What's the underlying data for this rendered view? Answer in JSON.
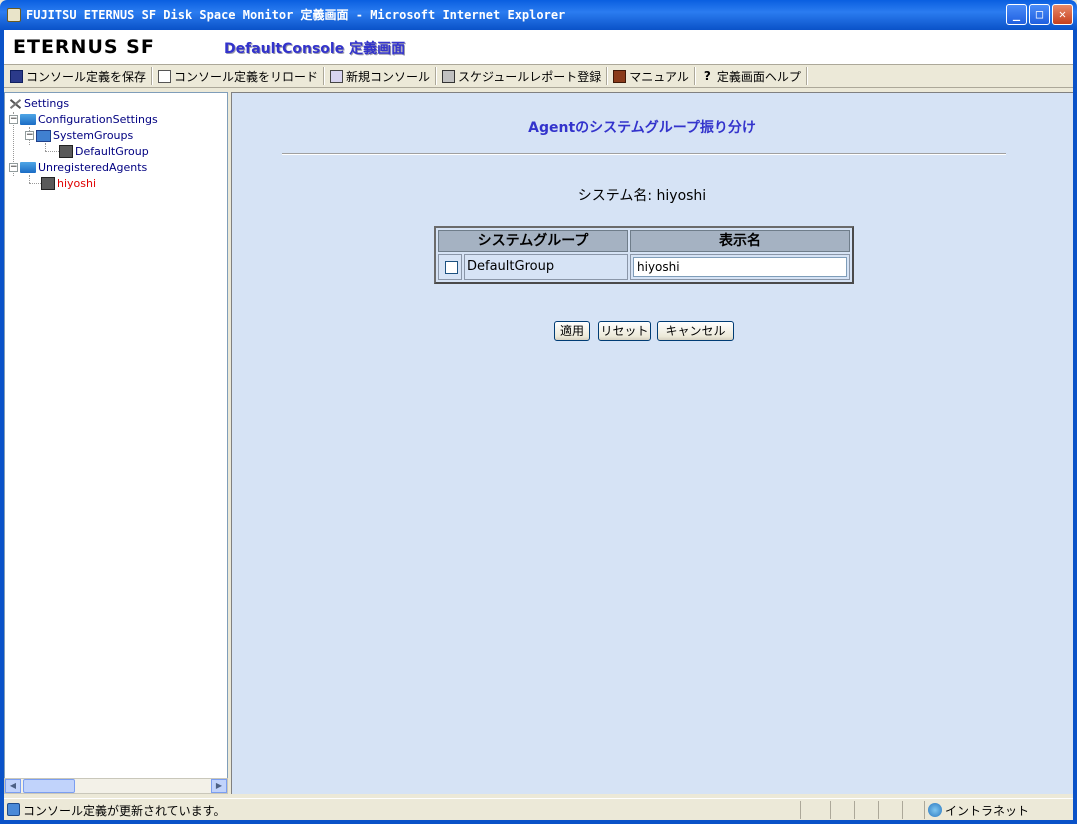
{
  "window": {
    "title": "FUJITSU ETERNUS SF Disk Space Monitor 定義画面 - Microsoft Internet Explorer"
  },
  "header": {
    "logo": "ETERNUS SF",
    "console_name": "DefaultConsole 定義画面"
  },
  "toolbar": {
    "items": [
      {
        "label": "コンソール定義を保存",
        "icon": "save-icon"
      },
      {
        "label": "コンソール定義をリロード",
        "icon": "reload-icon"
      },
      {
        "label": "新規コンソール",
        "icon": "new-console-icon"
      },
      {
        "label": "スケジュールレポート登録",
        "icon": "schedule-report-icon"
      },
      {
        "label": "マニュアル",
        "icon": "manual-icon"
      },
      {
        "label": "定義画面ヘルプ",
        "icon": "help-icon"
      }
    ]
  },
  "tree": {
    "root": "Settings",
    "configuration": "ConfigurationSettings",
    "system_groups": "SystemGroups",
    "default_group": "DefaultGroup",
    "unregistered": "UnregisteredAgents",
    "agent": "hiyoshi",
    "collapse_glyph": "−"
  },
  "main": {
    "heading": "Agentのシステムグループ振り分け",
    "system_name_label": "システム名: hiyoshi",
    "table": {
      "headers": [
        "システムグループ",
        "表示名"
      ],
      "rows": [
        {
          "group": "DefaultGroup",
          "display_name": "hiyoshi",
          "checked": false
        }
      ]
    },
    "buttons": {
      "apply": "適用",
      "reset": "リセット",
      "cancel": "キャンセル"
    }
  },
  "statusbar": {
    "message": "コンソール定義が更新されています。",
    "zone": "イントラネット"
  }
}
